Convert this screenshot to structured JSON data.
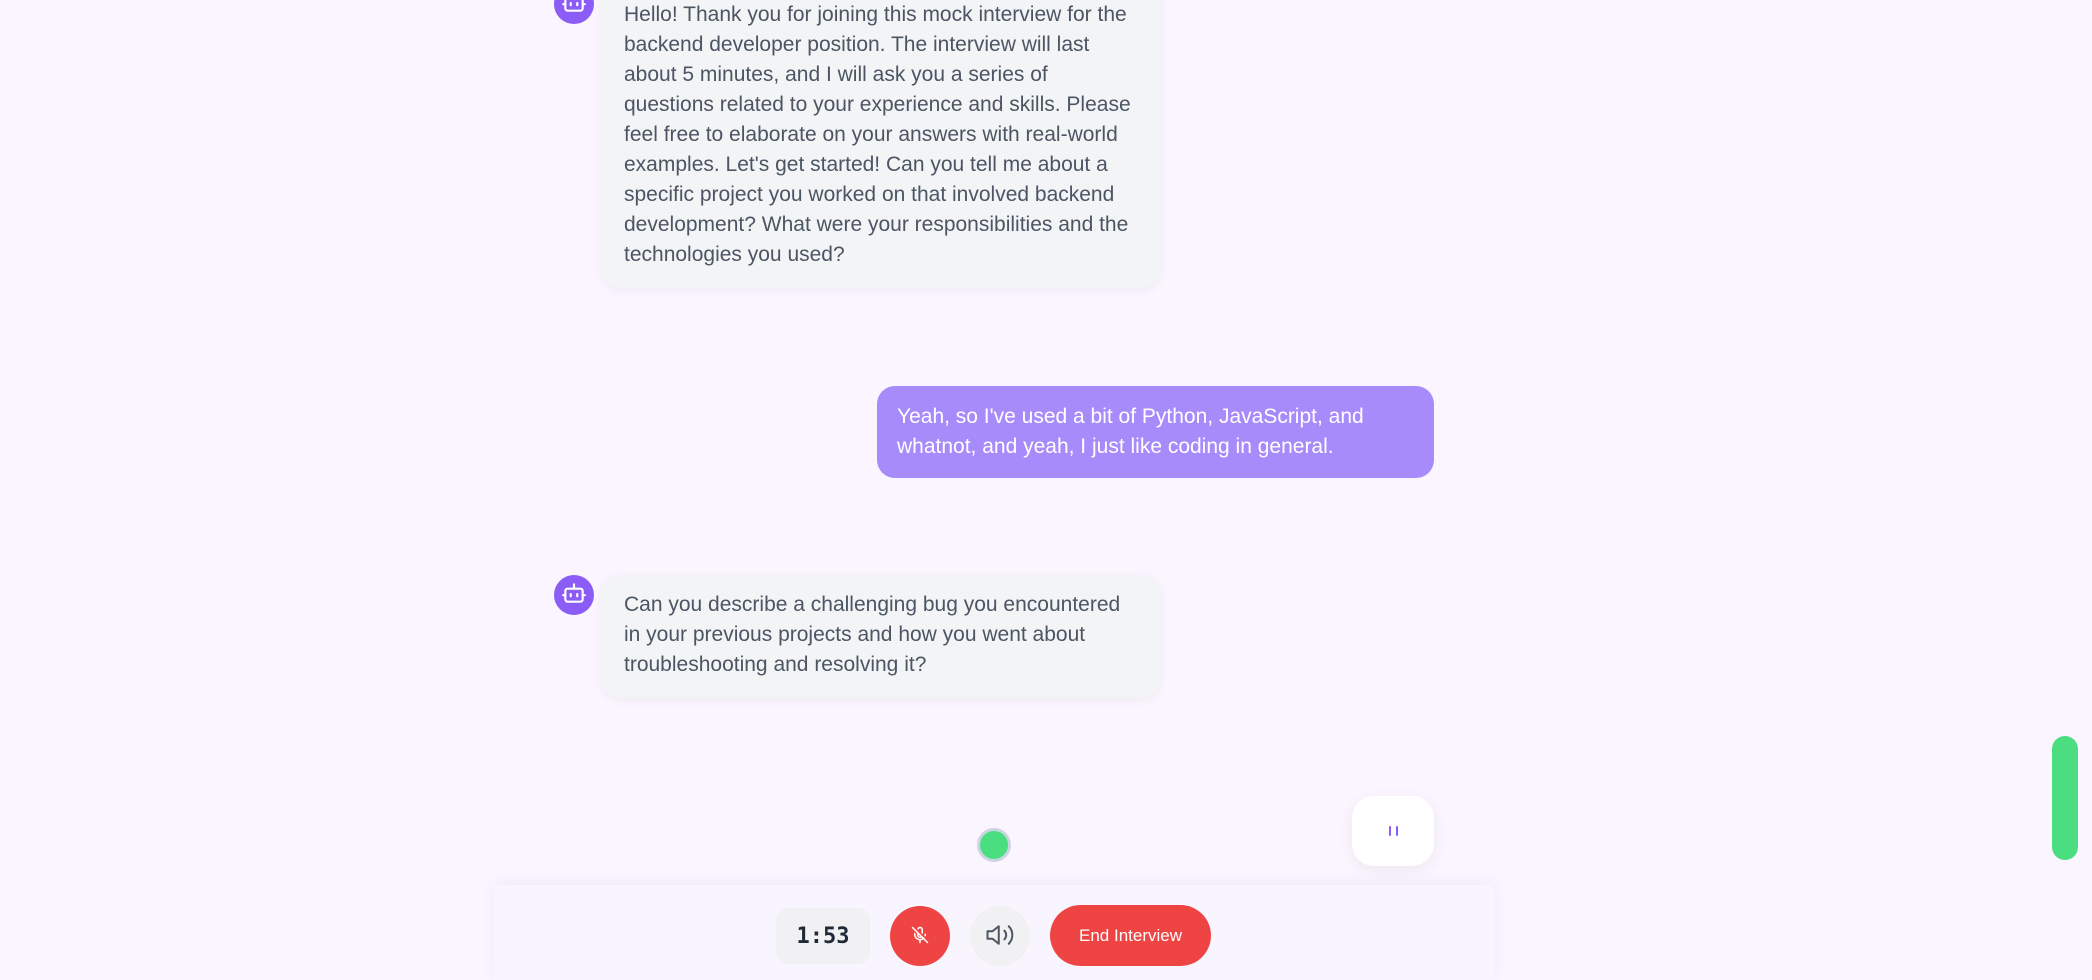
{
  "messages": [
    {
      "role": "bot",
      "icon": "robot-icon",
      "lines": [
        "Hello! Thank you for joining this mock interview for the",
        "backend developer position. The interview will last",
        "about 5 minutes, and I will ask you a series of",
        "questions related to your experience and skills. Please",
        "feel free to elaborate on your answers with real-world",
        "examples. Let's get started! Can you tell me about a",
        "specific project you worked on that involved backend",
        "development? What were your responsibilities and the",
        "technologies you used?"
      ]
    },
    {
      "role": "user",
      "lines": [
        "Yeah, so I've used a bit of Python, JavaScript, and",
        "whatnot, and yeah, I just like coding in general."
      ]
    },
    {
      "role": "bot",
      "icon": "robot-icon",
      "lines": [
        "Can you describe a challenging bug you encountered",
        "in your previous projects and how you went about",
        "troubleshooting and resolving it?"
      ]
    }
  ],
  "controls": {
    "timer": "1:53",
    "mic_icon": "mic-off-icon",
    "speaker_icon": "speaker-icon",
    "end_label": "End Interview"
  },
  "colors": {
    "accent": "#8b5cf6",
    "user_bubble": "#a78bfa",
    "danger": "#ef4444",
    "status_green": "#4ade80"
  }
}
